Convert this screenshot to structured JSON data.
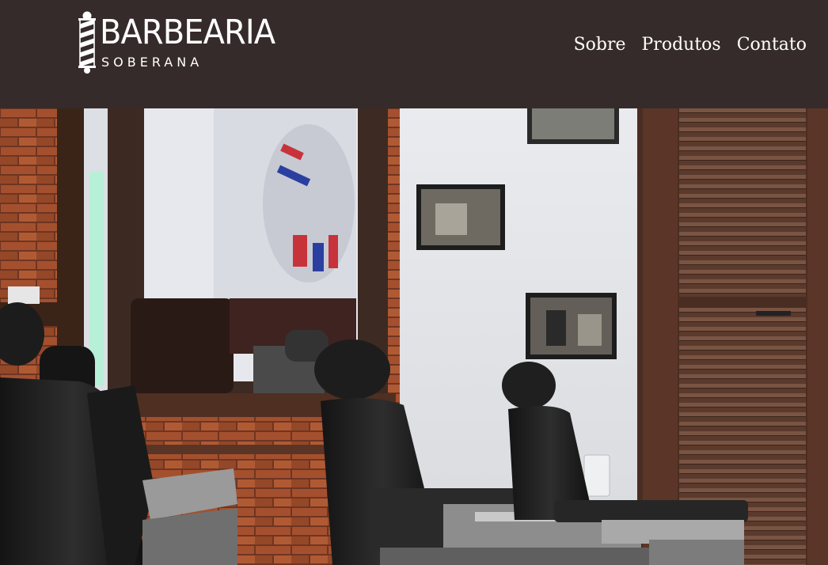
{
  "brand": {
    "name": "BARBEARIA",
    "tagline": "SOBERANA",
    "logo_icon": "barber-pole-icon"
  },
  "nav": {
    "items": [
      {
        "label": "Sobre"
      },
      {
        "label": "Produtos"
      },
      {
        "label": "Contato"
      }
    ]
  },
  "hero": {
    "image_subject": "barbershop interior with leather barber chairs, mirror, brick wall and framed photos"
  },
  "colors": {
    "header_bg": "#362b2b",
    "text": "#ffffff"
  }
}
